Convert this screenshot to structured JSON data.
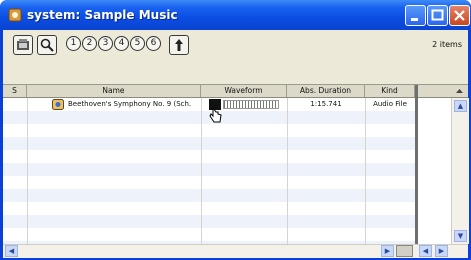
{
  "window": {
    "title": "system: Sample Music"
  },
  "toolbar": {
    "circles": [
      "1",
      "2",
      "3",
      "4",
      "5",
      "6"
    ],
    "item_count": "2 items"
  },
  "table": {
    "columns": [
      "S",
      "Name",
      "Waveform",
      "Abs. Duration",
      "Kind"
    ],
    "rows": [
      {
        "name": "Beethoven's Symphony No. 9 (Sch.",
        "duration": "1:15.741",
        "kind": "Audio File"
      }
    ]
  },
  "colors": {
    "title_bar": "#0b4de3",
    "row_stripe": "#eef3fb"
  }
}
